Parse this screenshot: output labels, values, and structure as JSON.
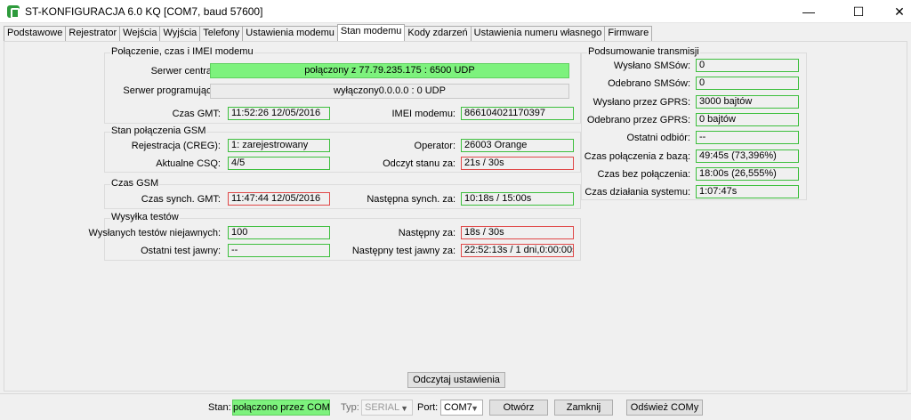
{
  "window": {
    "title": "ST-KONFIGURACJA 6.0 KQ   [COM7, baud 57600]",
    "min_glyph": "—",
    "max_glyph": "☐",
    "close_glyph": "✕"
  },
  "tabs": [
    {
      "label": "Podstawowe"
    },
    {
      "label": "Rejestrator"
    },
    {
      "label": "Wejścia"
    },
    {
      "label": "Wyjścia"
    },
    {
      "label": "Telefony"
    },
    {
      "label": "Ustawienia modemu"
    },
    {
      "label": "Stan modemu",
      "active": true
    },
    {
      "label": "Kody zdarzeń"
    },
    {
      "label": "Ustawienia numeru własnego"
    },
    {
      "label": "Firmware"
    }
  ],
  "group_conn": {
    "title": "Połączenie, czas i IMEI modemu",
    "server_central_label": "Serwer centrali:",
    "server_central_value": "połączony z 77.79.235.175 : 6500  UDP",
    "server_prog_label": "Serwer programujący:",
    "server_prog_value": "wyłączony0.0.0.0 : 0  UDP",
    "gmt_label": "Czas GMT:",
    "gmt_value": "11:52:26 12/05/2016",
    "imei_label": "IMEI modemu:",
    "imei_value": "866104021170397"
  },
  "group_gsm": {
    "title": "Stan połączenia GSM",
    "creg_label": "Rejestracja (CREG):",
    "creg_value": "1: zarejestrowany",
    "operator_label": "Operator:",
    "operator_value": "26003 Orange",
    "csq_label": "Aktualne CSQ:",
    "csq_value": "4/5",
    "read_label": "Odczyt stanu za:",
    "read_value": "21s / 30s"
  },
  "group_time": {
    "title": "Czas GSM",
    "sync_label": "Czas synch. GMT:",
    "sync_value": "11:47:44 12/05/2016",
    "next_label": "Następna synch. za:",
    "next_value": "10:18s / 15:00s"
  },
  "group_tests": {
    "title": "Wysyłka testów",
    "sent_label": "Wysłanych testów niejawnych:",
    "sent_value": "100",
    "next_label": "Następny za:",
    "next_value": "18s / 30s",
    "last_label": "Ostatni test jawny:",
    "last_value": "--",
    "next_open_label": "Następny test jawny za:",
    "next_open_value": "22:52:13s / 1 dni,0:00:00s"
  },
  "group_summary": {
    "title": "Podsumowanie transmisji",
    "rows": [
      {
        "label": "Wysłano SMSów:",
        "value": "0"
      },
      {
        "label": "Odebrano SMSów:",
        "value": "0"
      },
      {
        "label": "Wysłano przez GPRS:",
        "value": "3000 bajtów"
      },
      {
        "label": "Odebrano przez GPRS:",
        "value": "0 bajtów"
      },
      {
        "label": "Ostatni odbiór:",
        "value": "--"
      },
      {
        "label": "Czas połączenia z bazą:",
        "value": "49:45s  (73,396%)"
      },
      {
        "label": "Czas bez połączenia:",
        "value": "18:00s  (26,555%)"
      },
      {
        "label": "Czas działania systemu:",
        "value": "1:07:47s"
      }
    ]
  },
  "read_button": "Odczytaj ustawienia",
  "statusbar": {
    "stan_label": "Stan:",
    "stan_value": "połączono przez COM7",
    "typ_label": "Typ:",
    "typ_value": "SERIAL",
    "port_label": "Port:",
    "port_value": "COM7",
    "open_button": "Otwórz",
    "close_button": "Zamknij",
    "refresh_button": "Odśwież COMy"
  },
  "colors": {
    "ok_border": "#3dbf3d",
    "warn_border": "#e04848",
    "connected_fill": "#7df27d"
  }
}
